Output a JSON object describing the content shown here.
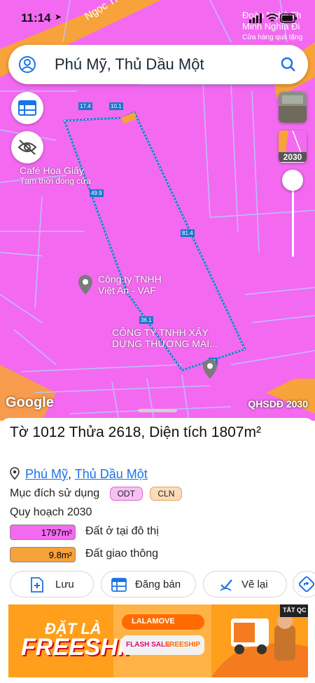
{
  "status_bar": {
    "time": "11:14"
  },
  "search": {
    "query": "Phú Mỹ, Thủ Dầu Một"
  },
  "map": {
    "street_label": "Ngọc Thạch",
    "top_right_poi": [
      "Đoàn Nghệ Th",
      "Minh Nghĩa Đi",
      "Cửa hàng quà tặng"
    ],
    "cafe_name": "Café Hoa Giấy",
    "cafe_status": "Tạm thời đóng cửa",
    "company1": [
      "Công ty TNHH",
      "Việt An - VAF"
    ],
    "company2": [
      "CÔNG TY TNHH XÂY",
      "DỰNG THƯƠNG MẠI..."
    ],
    "segment_lengths": [
      "17.4",
      "10.1",
      "49.9",
      "81.4",
      "36.1",
      "21"
    ],
    "google_logo": "Google",
    "plan_label": "QHSDĐ 2030",
    "layer_year": "2030"
  },
  "parcel": {
    "title": "Tờ 1012 Thửa 2618, Diện tích 1807m²",
    "ward": "Phú Mỹ",
    "separator": ",",
    "city": "Thủ Dầu Một",
    "purpose_label": "Mục đích sử dụng",
    "purpose_codes": [
      "ODT",
      "CLN"
    ],
    "plan_title": "Quy hoạch 2030",
    "plan_items": [
      {
        "area": "1797m²",
        "name": "Đất ở tại đô thị",
        "color": "#f36af0"
      },
      {
        "area": "9.8m²",
        "name": "Đất giao thông",
        "color": "#f7a23a"
      }
    ]
  },
  "actions": {
    "save": "Lưu",
    "post_sale": "Đăng bán",
    "redraw": "Vẽ lại"
  },
  "ad": {
    "close_label": "TẮT QC",
    "headline": "ĐẶT LÀ",
    "big_text": "FREESHIP",
    "brand": "LALAMOVE",
    "flash_sale": "FLASH SALE",
    "right_free": "FREESHIP"
  },
  "colors": {
    "map_pink": "#f36af0",
    "road_orange": "#f7a23a",
    "parcel_line": "#1c78c8",
    "accent_blue": "#1a73e8"
  }
}
